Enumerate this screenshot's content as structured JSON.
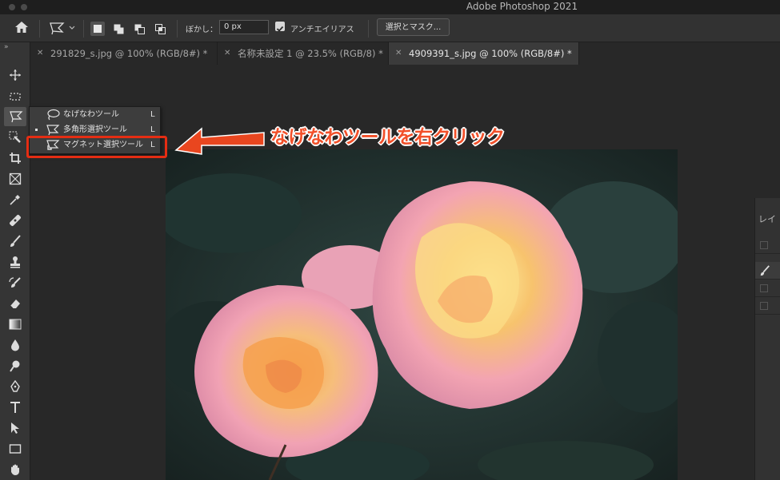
{
  "app": {
    "title": "Adobe Photoshop 2021"
  },
  "options_bar": {
    "feather_label": "ぼかし：",
    "feather_value": "0 px",
    "antialias_label": "アンチエイリアス",
    "antialias_checked": true,
    "select_mask_button": "選択とマスク..."
  },
  "tabs": [
    {
      "label": "291829_s.jpg @ 100% (RGB/8#) *",
      "active": false
    },
    {
      "label": "名称未設定 1 @ 23.5% (RGB/8) *",
      "active": false
    },
    {
      "label": "4909391_s.jpg @ 100% (RGB/8#) *",
      "active": true
    }
  ],
  "toolbar": {
    "collapse": "»",
    "tools": [
      "move-icon",
      "marquee-icon",
      "lasso-icon",
      "quick-select-icon",
      "crop-icon",
      "frame-icon",
      "eyedropper-icon",
      "healing-icon",
      "brush-icon",
      "stamp-icon",
      "history-brush-icon",
      "eraser-icon",
      "gradient-icon",
      "blur-icon",
      "dodge-icon",
      "pen-icon",
      "type-icon",
      "path-select-icon",
      "rectangle-icon",
      "hand-icon"
    ]
  },
  "lasso_flyout": {
    "items": [
      {
        "label": "なげなわツール",
        "key": "L",
        "icon": "lasso-icon",
        "current": false
      },
      {
        "label": "多角形選択ツール",
        "key": "L",
        "icon": "polygonal-lasso-icon",
        "current": true
      },
      {
        "label": "マグネット選択ツール",
        "key": "L",
        "icon": "magnetic-lasso-icon",
        "current": false
      }
    ]
  },
  "annotation": {
    "text": "なげなわツールを右クリック",
    "color": "#f2502a",
    "highlight_color": "#e52d13"
  },
  "right_panel": {
    "tab_label": "レイ"
  }
}
